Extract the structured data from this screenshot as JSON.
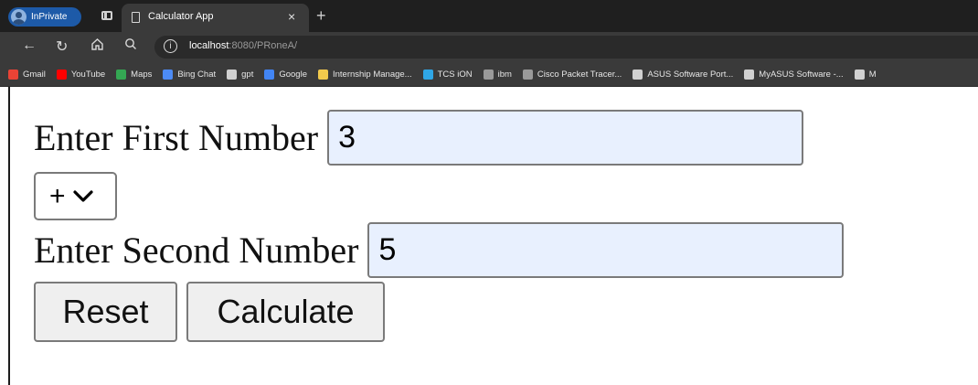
{
  "browser": {
    "inprivate_label": "InPrivate",
    "tab_title": "Calculator App",
    "tab_close": "×",
    "new_tab": "+",
    "url_host": "localhost",
    "url_path": ":8080/PRoneA/",
    "bookmarks": [
      {
        "label": "Gmail",
        "icon": "gmail-icon",
        "color": "#ea4335"
      },
      {
        "label": "YouTube",
        "icon": "youtube-icon",
        "color": "#ff0000"
      },
      {
        "label": "Maps",
        "icon": "maps-icon",
        "color": "#34a853"
      },
      {
        "label": "Bing Chat",
        "icon": "search-icon",
        "color": "#4c8bf5"
      },
      {
        "label": "gpt",
        "icon": "chatgpt-icon",
        "color": "#d0d0d0"
      },
      {
        "label": "Google",
        "icon": "google-icon",
        "color": "#4285f4"
      },
      {
        "label": "Internship Manage...",
        "icon": "folder-icon",
        "color": "#f2c94c"
      },
      {
        "label": "TCS iON",
        "icon": "power-icon",
        "color": "#2fa6e6"
      },
      {
        "label": "ibm",
        "icon": "ibm-icon",
        "color": "#9a9a9a"
      },
      {
        "label": "Cisco Packet Tracer...",
        "icon": "cisco-icon",
        "color": "#9a9a9a"
      },
      {
        "label": "ASUS Software Port...",
        "icon": "page-icon",
        "color": "#d0d0d0"
      },
      {
        "label": "MyASUS Software -...",
        "icon": "page-icon",
        "color": "#d0d0d0"
      },
      {
        "label": "M",
        "icon": "page-icon",
        "color": "#d0d0d0"
      }
    ]
  },
  "form": {
    "first_label": "Enter First Number",
    "first_value": "3",
    "operator_value": "+",
    "second_label": "Enter Second Number",
    "second_value": "5",
    "reset_label": "Reset",
    "calculate_label": "Calculate"
  }
}
